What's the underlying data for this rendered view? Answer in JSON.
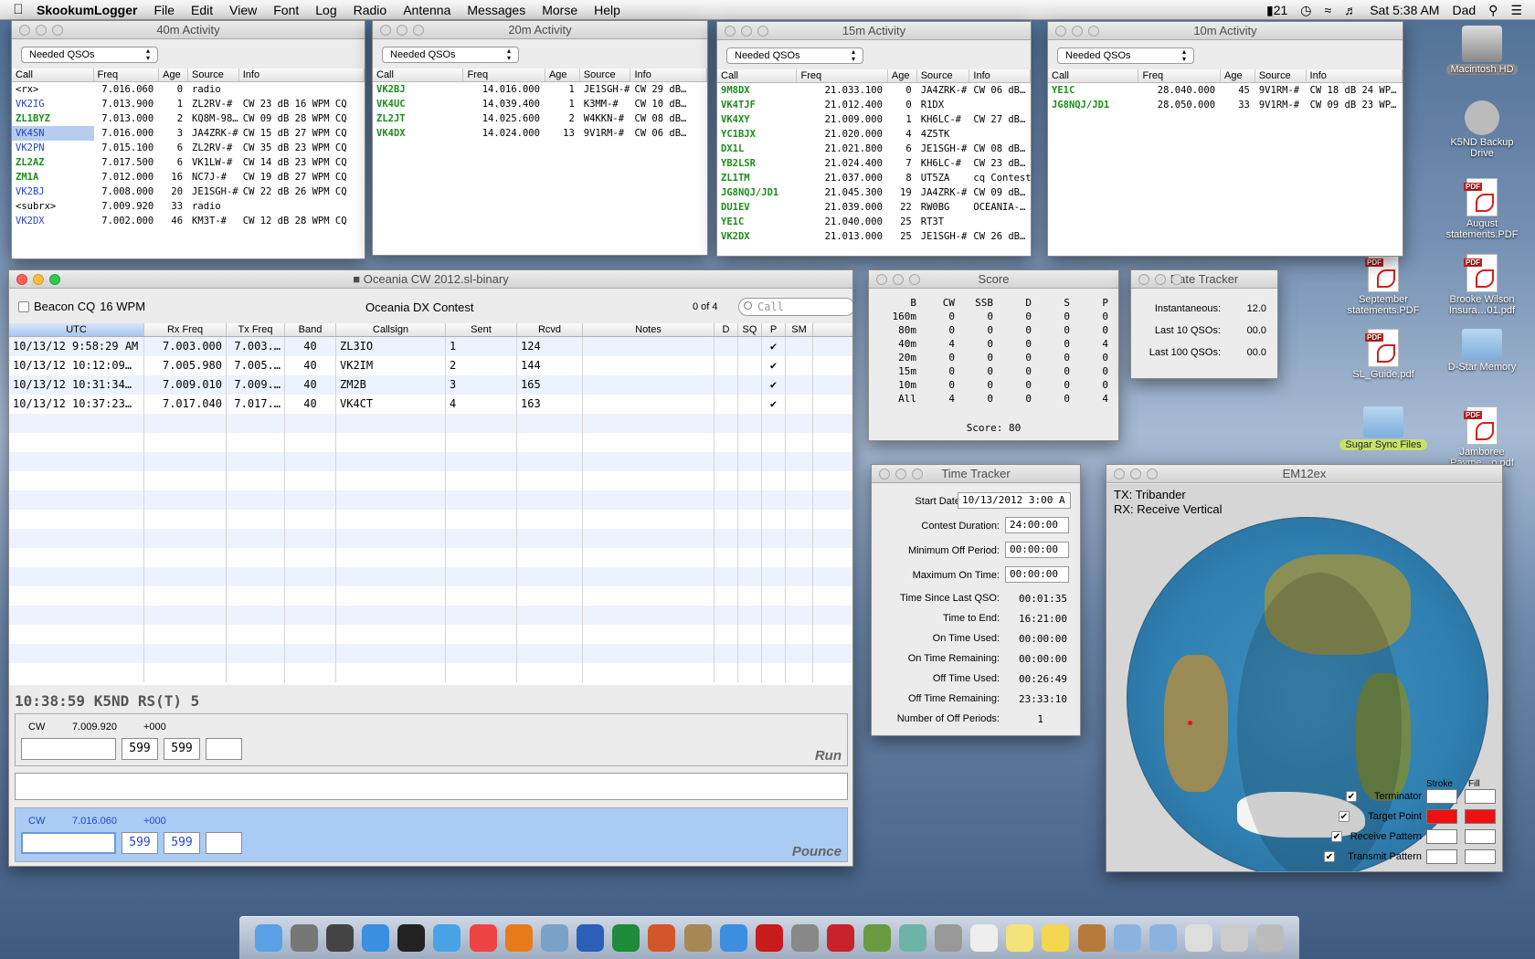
{
  "menubar": {
    "app": "SkookumLogger",
    "items": [
      "File",
      "Edit",
      "View",
      "Font",
      "Log",
      "Radio",
      "Antenna",
      "Messages",
      "Morse",
      "Help"
    ],
    "status": {
      "battery": "21",
      "clock": "Sat 5:38 AM",
      "user": "Dad"
    }
  },
  "activity_windows": [
    {
      "title": "40m Activity",
      "filter": "Needed QSOs",
      "headers": [
        "Call",
        "Freq",
        "Age",
        "Source",
        "Info"
      ],
      "rows": [
        {
          "call": "<rx>",
          "freq": "7.016.060",
          "age": "0",
          "source": "radio",
          "info": "",
          "c": "blk"
        },
        {
          "call": "VK2IG",
          "freq": "7.013.900",
          "age": "1",
          "source": "ZL2RV-#",
          "info": "CW 23 dB 16 WPM CQ",
          "c": "blue"
        },
        {
          "call": "ZL1BYZ",
          "freq": "7.013.000",
          "age": "2",
          "source": "KQ8M-98…",
          "info": "CW 09 dB 28 WPM CQ",
          "c": "green"
        },
        {
          "call": "VK4SN",
          "freq": "7.016.000",
          "age": "3",
          "source": "JA4ZRK-#",
          "info": "CW 15 dB 27 WPM CQ",
          "c": "blue",
          "sel": true
        },
        {
          "call": "VK2PN",
          "freq": "7.015.100",
          "age": "6",
          "source": "ZL2RV-#",
          "info": "CW 35 dB 23 WPM CQ",
          "c": "blue"
        },
        {
          "call": "ZL2AZ",
          "freq": "7.017.500",
          "age": "6",
          "source": "VK1LW-#",
          "info": "CW 14 dB 23 WPM CQ",
          "c": "green"
        },
        {
          "call": "ZM1A",
          "freq": "7.012.000",
          "age": "16",
          "source": "NC7J-#",
          "info": "CW 19 dB 27 WPM CQ",
          "c": "green"
        },
        {
          "call": "VK2BJ",
          "freq": "7.008.000",
          "age": "20",
          "source": "JE1SGH-#",
          "info": "CW 22 dB 26 WPM CQ",
          "c": "blue"
        },
        {
          "call": "<subrx>",
          "freq": "7.009.920",
          "age": "33",
          "source": "radio",
          "info": "",
          "c": "blk"
        },
        {
          "call": "VK2DX",
          "freq": "7.002.000",
          "age": "46",
          "source": "KM3T-#",
          "info": "CW 12 dB 28 WPM CQ",
          "c": "blue"
        }
      ]
    },
    {
      "title": "20m Activity",
      "filter": "Needed QSOs",
      "headers": [
        "Call",
        "Freq",
        "Age",
        "Source",
        "Info"
      ],
      "rows": [
        {
          "call": "VK2BJ",
          "freq": "14.016.000",
          "age": "1",
          "source": "JE1SGH-#",
          "info": "CW 29 dB…",
          "c": "green"
        },
        {
          "call": "VK4UC",
          "freq": "14.039.400",
          "age": "1",
          "source": "K3MM-#",
          "info": "CW 10 dB…",
          "c": "green"
        },
        {
          "call": "ZL2JT",
          "freq": "14.025.600",
          "age": "2",
          "source": "W4KKN-#",
          "info": "CW 08 dB…",
          "c": "green"
        },
        {
          "call": "VK4DX",
          "freq": "14.024.000",
          "age": "13",
          "source": "9V1RM-#",
          "info": "CW 06 dB…",
          "c": "green"
        }
      ]
    },
    {
      "title": "15m Activity",
      "filter": "Needed QSOs",
      "headers": [
        "Call",
        "Freq",
        "Age",
        "Source",
        "Info"
      ],
      "rows": [
        {
          "call": "9M8DX",
          "freq": "21.033.100",
          "age": "0",
          "source": "JA4ZRK-#",
          "info": "CW 06 dB…",
          "c": "green"
        },
        {
          "call": "VK4TJF",
          "freq": "21.012.400",
          "age": "0",
          "source": "R1DX",
          "info": "",
          "c": "green"
        },
        {
          "call": "VK4XY",
          "freq": "21.009.000",
          "age": "1",
          "source": "KH6LC-#",
          "info": "CW 27 dB…",
          "c": "green"
        },
        {
          "call": "YC1BJX",
          "freq": "21.020.000",
          "age": "4",
          "source": "4Z5TK",
          "info": "",
          "c": "green"
        },
        {
          "call": "DX1L",
          "freq": "21.021.800",
          "age": "6",
          "source": "JE1SGH-#",
          "info": "CW 08 dB…",
          "c": "green"
        },
        {
          "call": "YB2LSR",
          "freq": "21.024.400",
          "age": "7",
          "source": "KH6LC-#",
          "info": "CW 23 dB…",
          "c": "green"
        },
        {
          "call": "ZL1TM",
          "freq": "21.037.000",
          "age": "8",
          "source": "UT5ZA",
          "info": "cq Contest",
          "c": "green"
        },
        {
          "call": "JG8NQJ/JD1",
          "freq": "21.045.300",
          "age": "19",
          "source": "JA4ZRK-#",
          "info": "CW 09 dB…",
          "c": "green"
        },
        {
          "call": "DU1EV",
          "freq": "21.039.000",
          "age": "22",
          "source": "RW0BG",
          "info": "OCEANIA-…",
          "c": "green"
        },
        {
          "call": "YE1C",
          "freq": "21.040.000",
          "age": "25",
          "source": "RT3T",
          "info": "",
          "c": "green"
        },
        {
          "call": "VK2DX",
          "freq": "21.013.000",
          "age": "25",
          "source": "JE1SGH-#",
          "info": "CW 26 dB…",
          "c": "green"
        }
      ]
    },
    {
      "title": "10m Activity",
      "filter": "Needed QSOs",
      "headers": [
        "Call",
        "Freq",
        "Age",
        "Source",
        "Info"
      ],
      "rows": [
        {
          "call": "YE1C",
          "freq": "28.040.000",
          "age": "45",
          "source": "9V1RM-#",
          "info": "CW 18 dB 24 WP…",
          "c": "green"
        },
        {
          "call": "JG8NQJ/JD1",
          "freq": "28.050.000",
          "age": "33",
          "source": "9V1RM-#",
          "info": "CW 09 dB 23 WP…",
          "c": "green"
        }
      ]
    }
  ],
  "log": {
    "title": "Oceania CW 2012.sl-binary",
    "beacon": "Beacon CQ",
    "wpm": "16 WPM",
    "contest": "Oceania DX Contest",
    "count": "0 of 4",
    "search_placeholder": "Call",
    "headers": [
      "UTC",
      "Rx Freq",
      "Tx Freq",
      "Band",
      "Callsign",
      "Sent",
      "Rcvd",
      "Notes",
      "D",
      "SQ",
      "P",
      "SM"
    ],
    "rows": [
      {
        "utc": "10/13/12 9:58:29 AM",
        "rx": "7.003.000",
        "tx": "7.003.…",
        "band": "40",
        "call": "ZL3IO",
        "sent": "1",
        "rcvd": "124",
        "notes": "",
        "d": "",
        "sq": "",
        "p": "✔",
        "sm": ""
      },
      {
        "utc": "10/13/12 10:12:09…",
        "rx": "7.005.980",
        "tx": "7.005.…",
        "band": "40",
        "call": "VK2IM",
        "sent": "2",
        "rcvd": "144",
        "notes": "",
        "d": "",
        "sq": "",
        "p": "✔",
        "sm": ""
      },
      {
        "utc": "10/13/12 10:31:34…",
        "rx": "7.009.010",
        "tx": "7.009.…",
        "band": "40",
        "call": "ZM2B",
        "sent": "3",
        "rcvd": "165",
        "notes": "",
        "d": "",
        "sq": "",
        "p": "✔",
        "sm": ""
      },
      {
        "utc": "10/13/12 10:37:23…",
        "rx": "7.017.040",
        "tx": "7.017.…",
        "band": "40",
        "call": "VK4CT",
        "sent": "4",
        "rcvd": "163",
        "notes": "",
        "d": "",
        "sq": "",
        "p": "✔",
        "sm": ""
      }
    ],
    "clock_line": "10:38:59  K5ND RS(T) 5",
    "run": {
      "mode": "CW",
      "freq": "7.009.920",
      "offset": "+000",
      "rst1": "599",
      "rst2": "599",
      "label": "Run"
    },
    "pounce": {
      "mode": "CW",
      "freq": "7.016.060",
      "offset": "+000",
      "rst1": "599",
      "rst2": "599",
      "label": "Pounce"
    }
  },
  "score": {
    "title": "Score",
    "headers": [
      "B",
      "CW",
      "SSB",
      "D",
      "S",
      "P"
    ],
    "rows": [
      [
        "160m",
        "0",
        "0",
        "0",
        "0",
        "0"
      ],
      [
        "80m",
        "0",
        "0",
        "0",
        "0",
        "0"
      ],
      [
        "40m",
        "4",
        "0",
        "0",
        "0",
        "4"
      ],
      [
        "20m",
        "0",
        "0",
        "0",
        "0",
        "0"
      ],
      [
        "15m",
        "0",
        "0",
        "0",
        "0",
        "0"
      ],
      [
        "10m",
        "0",
        "0",
        "0",
        "0",
        "0"
      ],
      [
        "All",
        "4",
        "0",
        "0",
        "0",
        "4"
      ]
    ],
    "total": "Score: 80"
  },
  "rate": {
    "title": "Rate Tracker",
    "items": [
      {
        "label": "Instantaneous:",
        "value": "12.0"
      },
      {
        "label": "Last 10 QSOs:",
        "value": "00.0"
      },
      {
        "label": "Last 100 QSOs:",
        "value": "00.0"
      }
    ]
  },
  "time": {
    "title": "Time Tracker",
    "start_label": "Start Date:",
    "start_value": "10/13/2012  3:00 A",
    "boxes": [
      {
        "label": "Contest Duration:",
        "value": "24:00:00"
      },
      {
        "label": "Minimum Off Period:",
        "value": "00:00:00"
      },
      {
        "label": "Maximum On Time:",
        "value": "00:00:00"
      }
    ],
    "items": [
      {
        "label": "Time Since Last QSO:",
        "value": "00:01:35"
      },
      {
        "label": "Time to End:",
        "value": "16:21:00"
      },
      {
        "label": "On Time Used:",
        "value": "00:00:00"
      },
      {
        "label": "On Time Remaining:",
        "value": "00:00:00"
      },
      {
        "label": "Off Time Used:",
        "value": "00:26:49"
      },
      {
        "label": "Off Time Remaining:",
        "value": "23:33:10"
      },
      {
        "label": "Number of Off Periods:",
        "value": "1"
      }
    ]
  },
  "map": {
    "title": "EM12ex",
    "tx": "TX:  Tribander",
    "rx": "RX:  Receive Vertical",
    "stroke": "Stroke",
    "fill": "Fill",
    "legend": [
      {
        "label": "Terminator",
        "color": "#000000"
      },
      {
        "label": "Target Point",
        "color": "#ee1111"
      },
      {
        "label": "Receive Pattern",
        "color": "#000000"
      },
      {
        "label": "Transmit Pattern",
        "color": "#000000"
      }
    ]
  },
  "desktop": [
    {
      "label": "Macintosh HD",
      "type": "disk"
    },
    {
      "label": "K5ND Backup Drive",
      "type": "backup"
    },
    {
      "label": "August statements.PDF",
      "type": "pdf"
    },
    {
      "label": "September statements.PDF",
      "type": "pdf"
    },
    {
      "label": "Brooke Wilson Insura…01.pdf",
      "type": "pdf"
    },
    {
      "label": "SL_Guide.pdf",
      "type": "pdf"
    },
    {
      "label": "D-Star Memory",
      "type": "folder"
    },
    {
      "label": "Sugar Sync Files",
      "type": "folder"
    },
    {
      "label": "Jamboree Payme…o.pdf",
      "type": "pdf"
    }
  ]
}
